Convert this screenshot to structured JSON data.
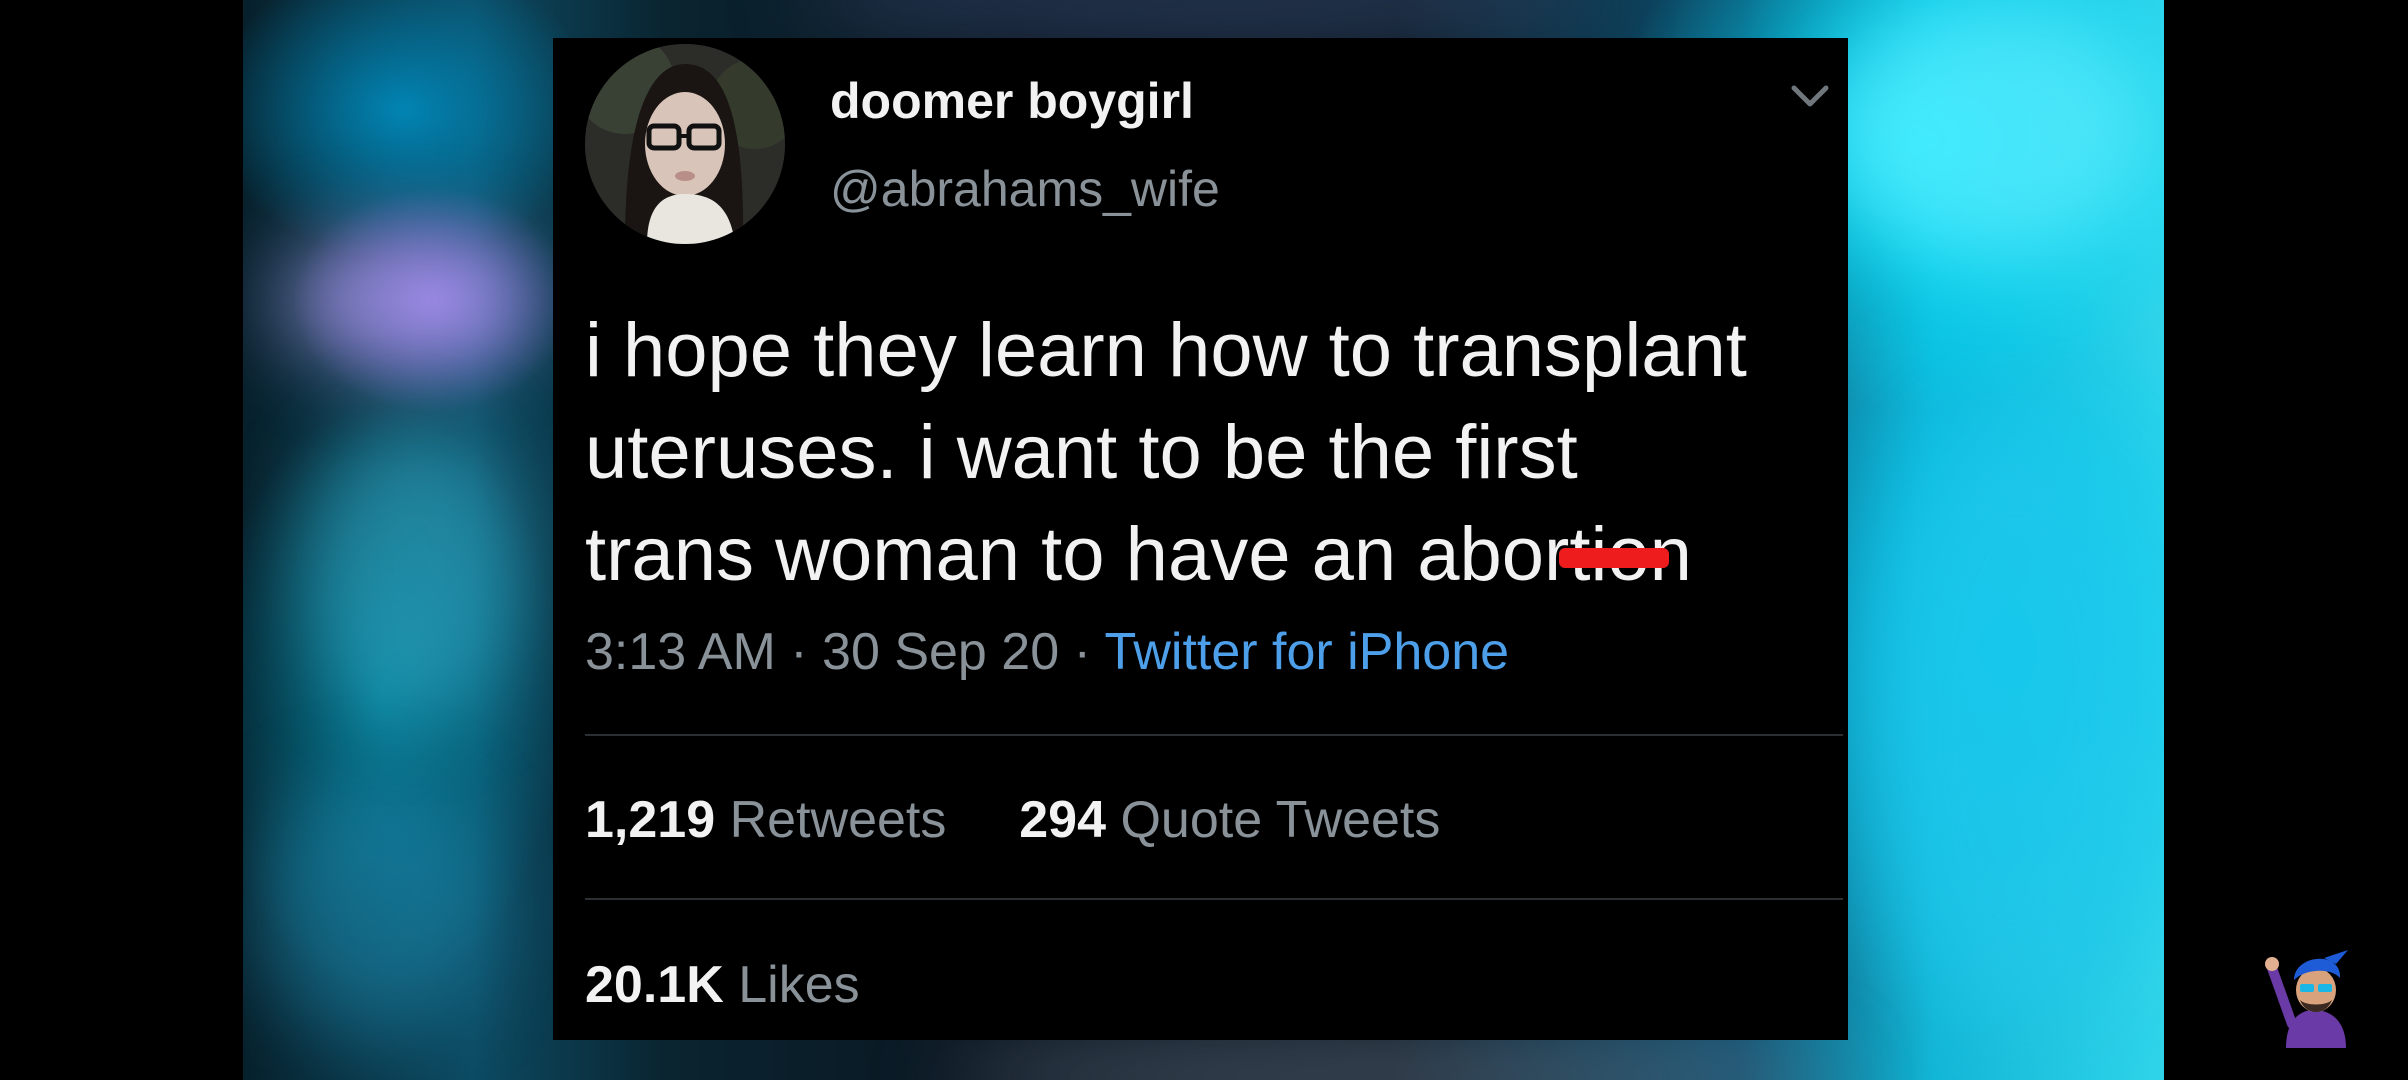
{
  "tweet": {
    "display_name": "doomer boygirl",
    "username": "@abrahams_wife",
    "text_lines": [
      "i hope they learn how to transplant",
      "uteruses. i want to be the first",
      "trans woman to have an abortion"
    ],
    "time": "3:13 AM",
    "date": "30 Sep 20",
    "separator": "·",
    "source": "Twitter for iPhone",
    "retweets_count": "1,219",
    "retweets_label": "Retweets",
    "quote_tweets_count": "294",
    "quote_tweets_label": "Quote Tweets",
    "likes_count": "20.1K",
    "likes_label": "Likes"
  },
  "icons": {
    "menu": "chevron-down-icon",
    "watermark": "channel-mascot-icon"
  },
  "colors": {
    "card_background": "#000000",
    "primary_text": "#f2f2f2",
    "secondary_text": "#8a9299",
    "link": "#4d9fe9",
    "redaction": "#ee1c1c",
    "background_accent": "#2fd4ea"
  }
}
